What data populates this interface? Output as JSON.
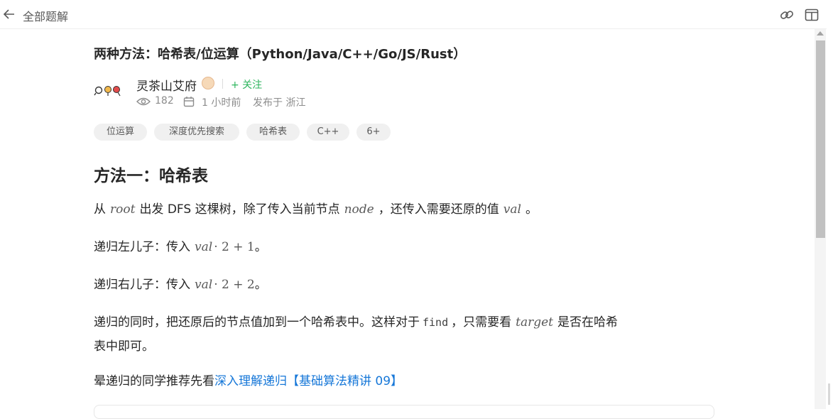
{
  "header": {
    "crumb": "全部题解"
  },
  "post": {
    "title": "两种方法：哈希表/位运算（Python/Java/C++/Go/JS/Rust）",
    "author": "灵茶山艾府",
    "follow": "+ 关注",
    "views": "182",
    "time": "1 小时前",
    "location": "发布于 浙江",
    "tags": [
      "位运算",
      "深度优先搜索",
      "哈希表",
      "C++",
      "6+"
    ]
  },
  "content": {
    "heading": "方法一：哈希表",
    "p1": {
      "a": "从",
      "m1": "root",
      "b": "出发 DFS 这棵树，除了传入当前节点",
      "m2": "node",
      "c": "，还传入需要还原的值",
      "m3": "val",
      "d": "。"
    },
    "p2": {
      "a": "递归左儿子：传入",
      "m": "val",
      "expr": "· 2 + 1",
      "d": "。"
    },
    "p3": {
      "a": "递归右儿子：传入",
      "m": "val",
      "expr": "· 2 + 2",
      "d": "。"
    },
    "p4": {
      "a": "递归的同时，把还原后的节点值加到一个哈希表中。这样对于",
      "code": "find",
      "b": "，只需要看",
      "m": "target",
      "c": "是否在哈希",
      "line2": "表中即可。"
    },
    "p5": {
      "a": "晕递归的同学推荐先看",
      "link": "深入理解递归【基础算法精讲 09】"
    }
  }
}
